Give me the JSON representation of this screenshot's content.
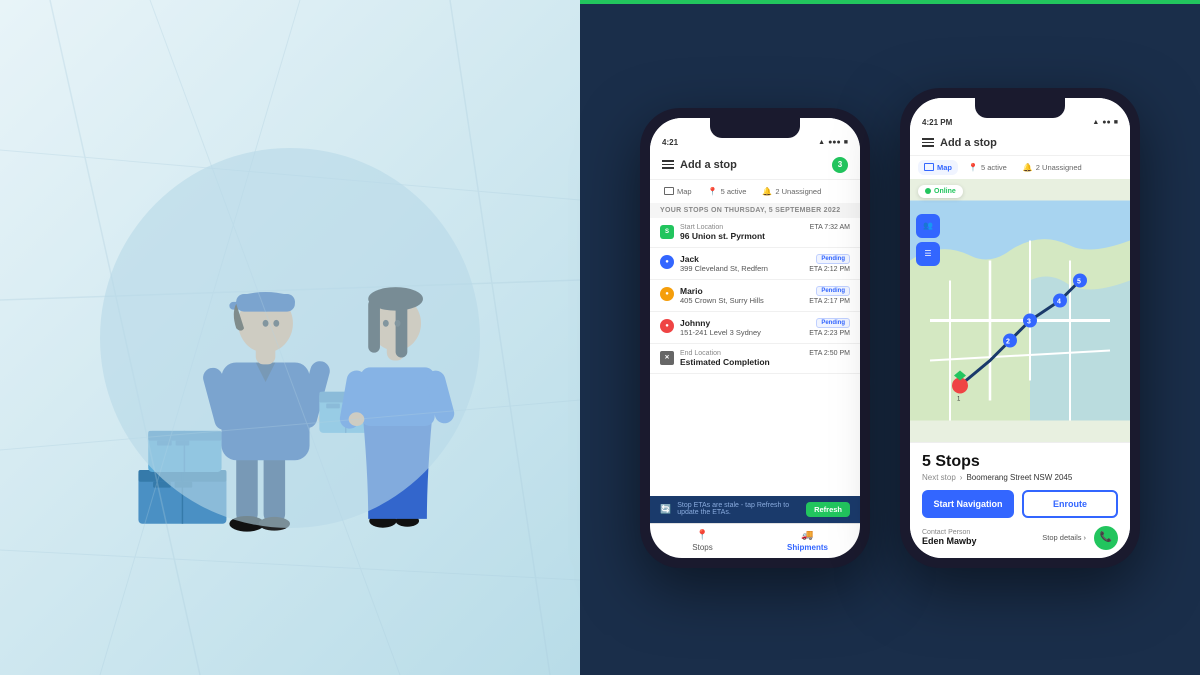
{
  "left": {
    "alt": "Delivery illustration"
  },
  "phone1": {
    "status_bar": {
      "time": "4:21",
      "icons": "▲ ● ■"
    },
    "header": {
      "title": "Add a stop",
      "badge": "3"
    },
    "tabs": [
      {
        "label": "Map",
        "active": false
      },
      {
        "label": "5 active",
        "active": false
      },
      {
        "label": "2 Unassigned",
        "active": false
      }
    ],
    "date_header": "YOUR STOPS ON THURSDAY, 5 SEPTEMBER 2022",
    "stops": [
      {
        "type": "start",
        "label": "Start Location",
        "name": "96 Union st. Pyrmont",
        "eta": "ETA 7:32 AM",
        "status": ""
      },
      {
        "type": "blue",
        "label": "",
        "name": "Jack",
        "address": "399 Cleveland St, Redfern",
        "eta": "ETA 2:12 PM",
        "status": "Pending"
      },
      {
        "type": "orange",
        "label": "",
        "name": "Mario",
        "address": "405 Crown St, Surry Hills",
        "eta": "ETA 2:17 PM",
        "status": "Pending"
      },
      {
        "type": "red",
        "label": "",
        "name": "Johnny",
        "address": "151-241 Level 3 Sydney",
        "eta": "ETA 2:23 PM",
        "status": "Pending"
      },
      {
        "type": "end",
        "label": "End Location",
        "name": "Estimated Completion",
        "eta": "ETA 2:50 PM",
        "status": ""
      }
    ],
    "refresh_bar": {
      "text": "Stop ETAs are stale - tap Refresh to update the ETAs.",
      "btn": "Refresh"
    },
    "bottom_nav": [
      {
        "icon": "📍",
        "label": "Stops",
        "active": false
      },
      {
        "icon": "🚚",
        "label": "Shipments",
        "active": true
      }
    ]
  },
  "phone2": {
    "status_bar": {
      "time": "4:21 PM",
      "icons": "▲ ● ■"
    },
    "header": {
      "title": "Add a stop"
    },
    "tabs": [
      {
        "label": "Map",
        "active": true
      },
      {
        "label": "5 active",
        "active": false
      },
      {
        "label": "2 Unassigned",
        "active": false
      }
    ],
    "online_badge": "Online",
    "stops_panel": {
      "count": "5 Stops",
      "next_stop_label": "Next stop",
      "next_stop_address": "Boomerang Street NSW 2045",
      "btn_start": "Start Navigation",
      "btn_enroute": "Enroute",
      "contact_label": "Contact Person",
      "contact_name": "Eden Mawby",
      "stop_details": "Stop details"
    }
  }
}
